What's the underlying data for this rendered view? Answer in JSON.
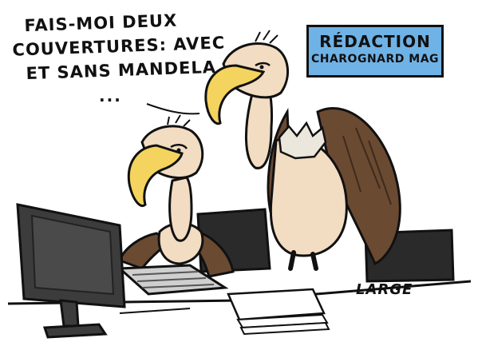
{
  "speech_bubble": {
    "line1": "FAIS-MOI DEUX",
    "line2": "COUVERTURES: AVEC",
    "line3": "ET SANS MANDELA",
    "ellipsis": "..."
  },
  "sign": {
    "line1": "RÉDACTION",
    "line2": "CHAROGNARD MAG",
    "color": "#6fb2e6"
  },
  "signature": "LARGE",
  "colors": {
    "beak": "#f4d35e",
    "feathers": "#6b4a32",
    "skin": "#f2dcc2",
    "monitor": "#3c3c3c"
  }
}
